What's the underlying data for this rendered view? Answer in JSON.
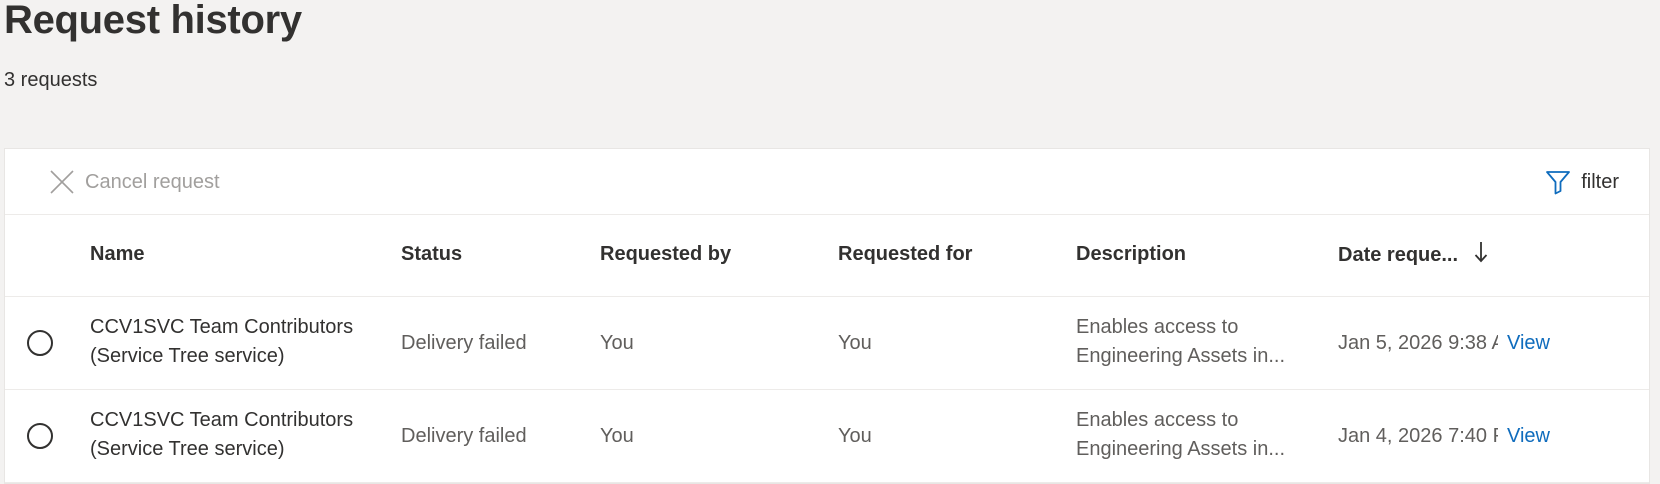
{
  "page": {
    "title": "Request history",
    "count_text": "3 requests"
  },
  "toolbar": {
    "cancel_label": "Cancel request",
    "cancel_icon": "close-icon",
    "filter_label": "filter",
    "filter_icon": "filter-icon"
  },
  "colors": {
    "background": "#f3f2f1",
    "panel": "#ffffff",
    "link": "#0f6cbd",
    "disabled_text": "#a19f9d",
    "primary_text": "#323130",
    "secondary_text": "#605e5c"
  },
  "table": {
    "columns": {
      "name": "Name",
      "status": "Status",
      "requested_by": "Requested by",
      "requested_for": "Requested for",
      "description": "Description",
      "date_requested": "Date reque...",
      "sort_icon": "arrow-down-icon"
    },
    "rows": [
      {
        "name": "CCV1SVC Team Contributors (Service Tree service)",
        "status": "Delivery failed",
        "requested_by": "You",
        "requested_for": "You",
        "description_line1": "Enables access to",
        "description_line2": "Engineering Assets in...",
        "date": "Jan 5, 2026 9:38 A",
        "action": "View"
      },
      {
        "name": "CCV1SVC Team Contributors (Service Tree service)",
        "status": "Delivery failed",
        "requested_by": "You",
        "requested_for": "You",
        "description_line1": "Enables access to",
        "description_line2": "Engineering Assets in...",
        "date": "Jan 4, 2026 7:40 P",
        "action": "View"
      }
    ]
  }
}
